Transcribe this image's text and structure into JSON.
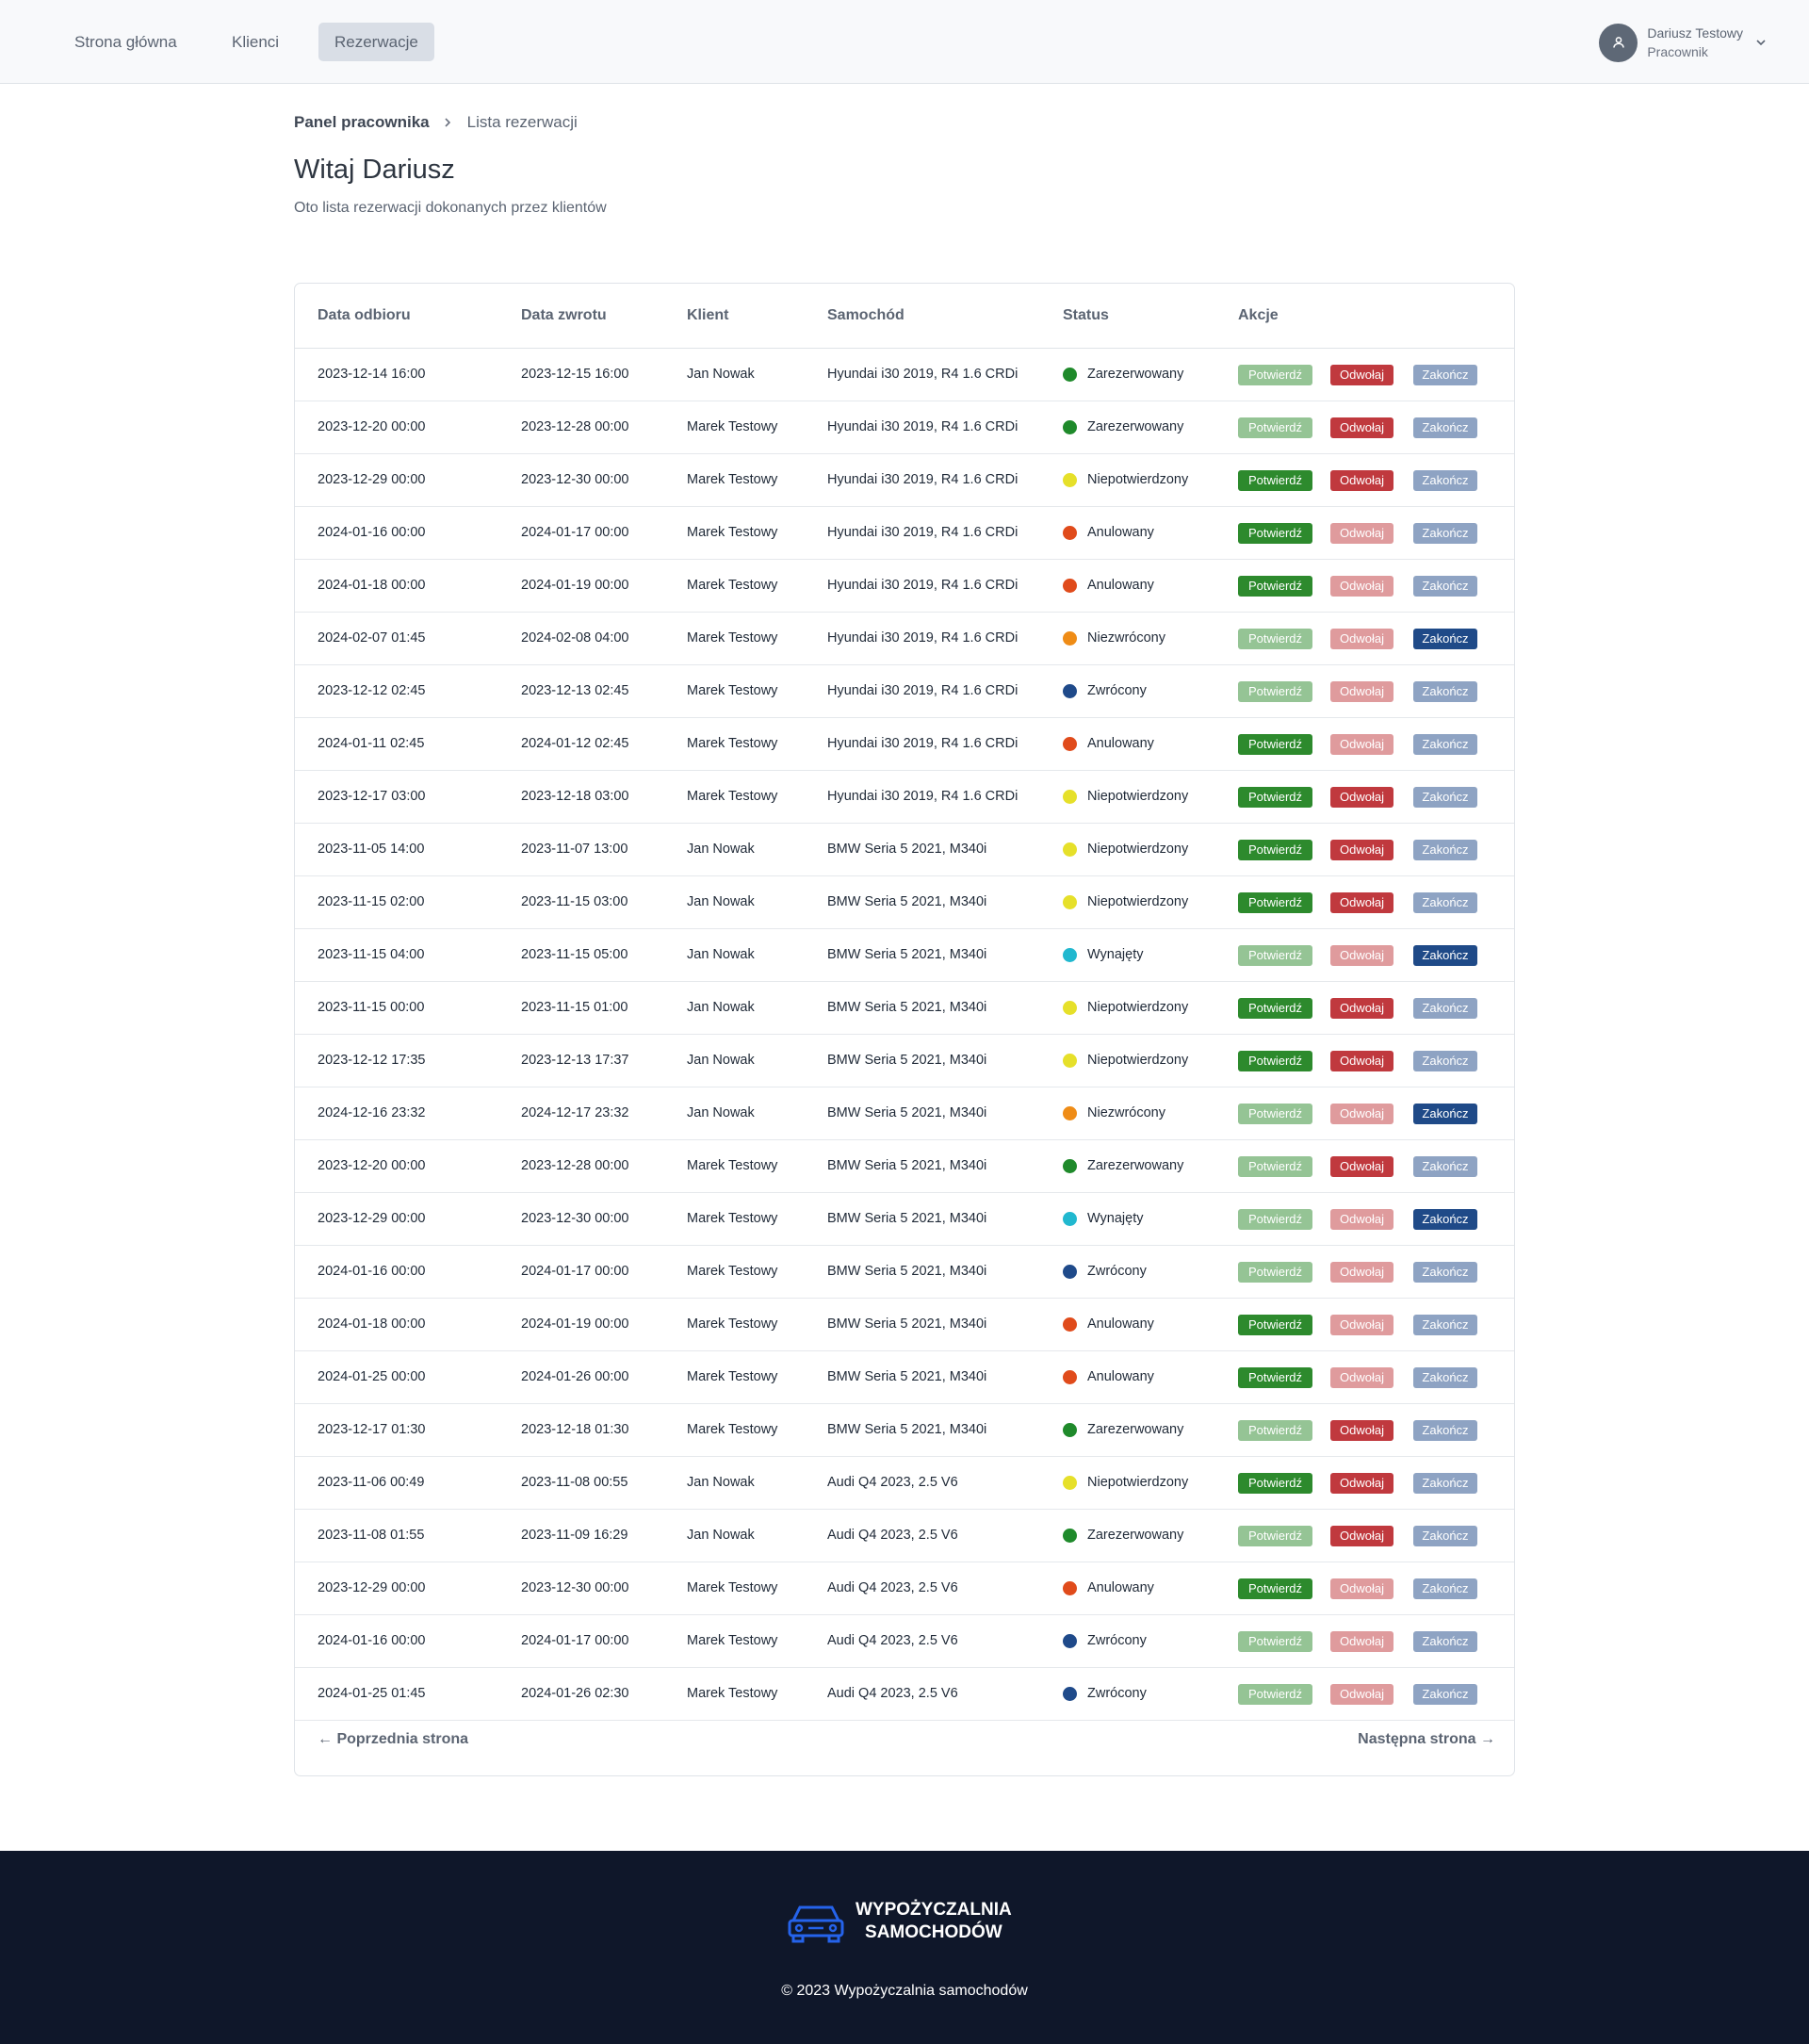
{
  "nav": {
    "links": [
      "Strona główna",
      "Klienci",
      "Rezerwacje"
    ],
    "active_index": 2
  },
  "user": {
    "name": "Dariusz Testowy",
    "role": "Pracownik"
  },
  "breadcrumb": {
    "home": "Panel pracownika",
    "current": "Lista rezerwacji"
  },
  "page": {
    "title": "Witaj Dariusz",
    "subtitle": "Oto lista rezerwacji dokonanych przez klientów"
  },
  "table": {
    "headers": [
      "Data odbioru",
      "Data zwrotu",
      "Klient",
      "Samochód",
      "Status",
      "Akcje"
    ],
    "actions": {
      "confirm": "Potwierdź",
      "cancel": "Odwołaj",
      "finish": "Zakończ"
    },
    "status_colors": {
      "Zarezerwowany": "#1f8a2b",
      "Niepotwierdzony": "#e6e02a",
      "Anulowany": "#e04b1b",
      "Niezwrócony": "#ef8c16",
      "Zwrócony": "#1f4a8a",
      "Wynajęty": "#21b8cf"
    },
    "rows": [
      {
        "pickup": "2023-12-14 16:00",
        "return": "2023-12-15 16:00",
        "client": "Jan Nowak",
        "car": "Hyundai i30 2019, R4 1.6 CRDi",
        "status": "Zarezerwowany",
        "confirm": false,
        "cancel": true,
        "finish": false
      },
      {
        "pickup": "2023-12-20 00:00",
        "return": "2023-12-28 00:00",
        "client": "Marek Testowy",
        "car": "Hyundai i30 2019, R4 1.6 CRDi",
        "status": "Zarezerwowany",
        "confirm": false,
        "cancel": true,
        "finish": false
      },
      {
        "pickup": "2023-12-29 00:00",
        "return": "2023-12-30 00:00",
        "client": "Marek Testowy",
        "car": "Hyundai i30 2019, R4 1.6 CRDi",
        "status": "Niepotwierdzony",
        "confirm": true,
        "cancel": true,
        "finish": false
      },
      {
        "pickup": "2024-01-16 00:00",
        "return": "2024-01-17 00:00",
        "client": "Marek Testowy",
        "car": "Hyundai i30 2019, R4 1.6 CRDi",
        "status": "Anulowany",
        "confirm": true,
        "cancel": false,
        "finish": false
      },
      {
        "pickup": "2024-01-18 00:00",
        "return": "2024-01-19 00:00",
        "client": "Marek Testowy",
        "car": "Hyundai i30 2019, R4 1.6 CRDi",
        "status": "Anulowany",
        "confirm": true,
        "cancel": false,
        "finish": false
      },
      {
        "pickup": "2024-02-07 01:45",
        "return": "2024-02-08 04:00",
        "client": "Marek Testowy",
        "car": "Hyundai i30 2019, R4 1.6 CRDi",
        "status": "Niezwrócony",
        "confirm": false,
        "cancel": false,
        "finish": true
      },
      {
        "pickup": "2023-12-12 02:45",
        "return": "2023-12-13 02:45",
        "client": "Marek Testowy",
        "car": "Hyundai i30 2019, R4 1.6 CRDi",
        "status": "Zwrócony",
        "confirm": false,
        "cancel": false,
        "finish": false
      },
      {
        "pickup": "2024-01-11 02:45",
        "return": "2024-01-12 02:45",
        "client": "Marek Testowy",
        "car": "Hyundai i30 2019, R4 1.6 CRDi",
        "status": "Anulowany",
        "confirm": true,
        "cancel": false,
        "finish": false
      },
      {
        "pickup": "2023-12-17 03:00",
        "return": "2023-12-18 03:00",
        "client": "Marek Testowy",
        "car": "Hyundai i30 2019, R4 1.6 CRDi",
        "status": "Niepotwierdzony",
        "confirm": true,
        "cancel": true,
        "finish": false
      },
      {
        "pickup": "2023-11-05 14:00",
        "return": "2023-11-07 13:00",
        "client": "Jan Nowak",
        "car": "BMW Seria 5 2021, M340i",
        "status": "Niepotwierdzony",
        "confirm": true,
        "cancel": true,
        "finish": false
      },
      {
        "pickup": "2023-11-15 02:00",
        "return": "2023-11-15 03:00",
        "client": "Jan Nowak",
        "car": "BMW Seria 5 2021, M340i",
        "status": "Niepotwierdzony",
        "confirm": true,
        "cancel": true,
        "finish": false
      },
      {
        "pickup": "2023-11-15 04:00",
        "return": "2023-11-15 05:00",
        "client": "Jan Nowak",
        "car": "BMW Seria 5 2021, M340i",
        "status": "Wynajęty",
        "confirm": false,
        "cancel": false,
        "finish": true
      },
      {
        "pickup": "2023-11-15 00:00",
        "return": "2023-11-15 01:00",
        "client": "Jan Nowak",
        "car": "BMW Seria 5 2021, M340i",
        "status": "Niepotwierdzony",
        "confirm": true,
        "cancel": true,
        "finish": false
      },
      {
        "pickup": "2023-12-12 17:35",
        "return": "2023-12-13 17:37",
        "client": "Jan Nowak",
        "car": "BMW Seria 5 2021, M340i",
        "status": "Niepotwierdzony",
        "confirm": true,
        "cancel": true,
        "finish": false
      },
      {
        "pickup": "2024-12-16 23:32",
        "return": "2024-12-17 23:32",
        "client": "Jan Nowak",
        "car": "BMW Seria 5 2021, M340i",
        "status": "Niezwrócony",
        "confirm": false,
        "cancel": false,
        "finish": true
      },
      {
        "pickup": "2023-12-20 00:00",
        "return": "2023-12-28 00:00",
        "client": "Marek Testowy",
        "car": "BMW Seria 5 2021, M340i",
        "status": "Zarezerwowany",
        "confirm": false,
        "cancel": true,
        "finish": false
      },
      {
        "pickup": "2023-12-29 00:00",
        "return": "2023-12-30 00:00",
        "client": "Marek Testowy",
        "car": "BMW Seria 5 2021, M340i",
        "status": "Wynajęty",
        "confirm": false,
        "cancel": false,
        "finish": true
      },
      {
        "pickup": "2024-01-16 00:00",
        "return": "2024-01-17 00:00",
        "client": "Marek Testowy",
        "car": "BMW Seria 5 2021, M340i",
        "status": "Zwrócony",
        "confirm": false,
        "cancel": false,
        "finish": false
      },
      {
        "pickup": "2024-01-18 00:00",
        "return": "2024-01-19 00:00",
        "client": "Marek Testowy",
        "car": "BMW Seria 5 2021, M340i",
        "status": "Anulowany",
        "confirm": true,
        "cancel": false,
        "finish": false
      },
      {
        "pickup": "2024-01-25 00:00",
        "return": "2024-01-26 00:00",
        "client": "Marek Testowy",
        "car": "BMW Seria 5 2021, M340i",
        "status": "Anulowany",
        "confirm": true,
        "cancel": false,
        "finish": false
      },
      {
        "pickup": "2023-12-17 01:30",
        "return": "2023-12-18 01:30",
        "client": "Marek Testowy",
        "car": "BMW Seria 5 2021, M340i",
        "status": "Zarezerwowany",
        "confirm": false,
        "cancel": true,
        "finish": false
      },
      {
        "pickup": "2023-11-06 00:49",
        "return": "2023-11-08 00:55",
        "client": "Jan Nowak",
        "car": "Audi Q4 2023, 2.5 V6",
        "status": "Niepotwierdzony",
        "confirm": true,
        "cancel": true,
        "finish": false
      },
      {
        "pickup": "2023-11-08 01:55",
        "return": "2023-11-09 16:29",
        "client": "Jan Nowak",
        "car": "Audi Q4 2023, 2.5 V6",
        "status": "Zarezerwowany",
        "confirm": false,
        "cancel": true,
        "finish": false
      },
      {
        "pickup": "2023-12-29 00:00",
        "return": "2023-12-30 00:00",
        "client": "Marek Testowy",
        "car": "Audi Q4 2023, 2.5 V6",
        "status": "Anulowany",
        "confirm": true,
        "cancel": false,
        "finish": false
      },
      {
        "pickup": "2024-01-16 00:00",
        "return": "2024-01-17 00:00",
        "client": "Marek Testowy",
        "car": "Audi Q4 2023, 2.5 V6",
        "status": "Zwrócony",
        "confirm": false,
        "cancel": false,
        "finish": false
      },
      {
        "pickup": "2024-01-25 01:45",
        "return": "2024-01-26 02:30",
        "client": "Marek Testowy",
        "car": "Audi Q4 2023, 2.5 V6",
        "status": "Zwrócony",
        "confirm": false,
        "cancel": false,
        "finish": false
      }
    ]
  },
  "pager": {
    "prev": "Poprzednia strona",
    "next": "Następna strona"
  },
  "footer": {
    "logo_line1": "WYPOŻYCZALNIA",
    "logo_line2": "SAMOCHODÓW",
    "copyright": "© 2023 Wypożyczalnia samochodów",
    "logo_icon": "car-icon"
  },
  "colors": {
    "confirm": "#2d8a2d",
    "cancel": "#c0393e",
    "finish": "#1f4a88",
    "footer_bg": "#0f172a",
    "logo_blue": "#2563eb"
  }
}
